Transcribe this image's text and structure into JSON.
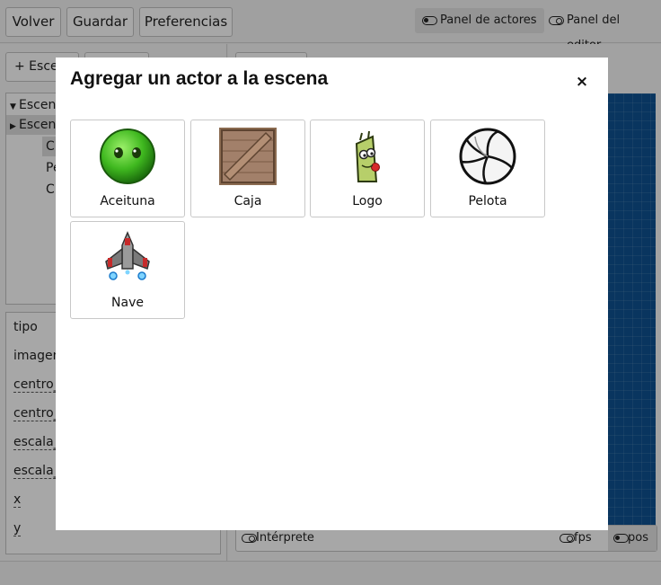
{
  "topbar": {
    "back_label": "Volver",
    "save_label": "Guardar",
    "prefs_label": "Preferencias",
    "actors_panel_label": "Panel de actores",
    "editor_panel_label": "Panel del editor"
  },
  "left_panel": {
    "add_scene_label": "+ Esce",
    "tree": [
      {
        "label": "Escen"
      },
      {
        "label": "Escen"
      },
      {
        "label": "C"
      },
      {
        "label": "Pe"
      },
      {
        "label": "C"
      }
    ],
    "props": [
      {
        "label": "tipo"
      },
      {
        "label": "imagen"
      },
      {
        "label": "centro_"
      },
      {
        "label": "centro_"
      },
      {
        "label": "escala_"
      },
      {
        "label": "escala_"
      },
      {
        "label": "x"
      },
      {
        "label": "y"
      }
    ]
  },
  "right_panel": {
    "bottom": {
      "interpreter_label": "Intérprete",
      "fps_label": "fps",
      "pos_label": "pos"
    }
  },
  "modal": {
    "title": "Agregar un actor a la escena",
    "close_symbol": "×",
    "actors": [
      {
        "label": "Aceituna",
        "icon": "olive-icon"
      },
      {
        "label": "Caja",
        "icon": "crate-icon"
      },
      {
        "label": "Logo",
        "icon": "logo-icon"
      },
      {
        "label": "Pelota",
        "icon": "ball-icon"
      },
      {
        "label": "Nave",
        "icon": "spaceship-icon"
      }
    ]
  }
}
